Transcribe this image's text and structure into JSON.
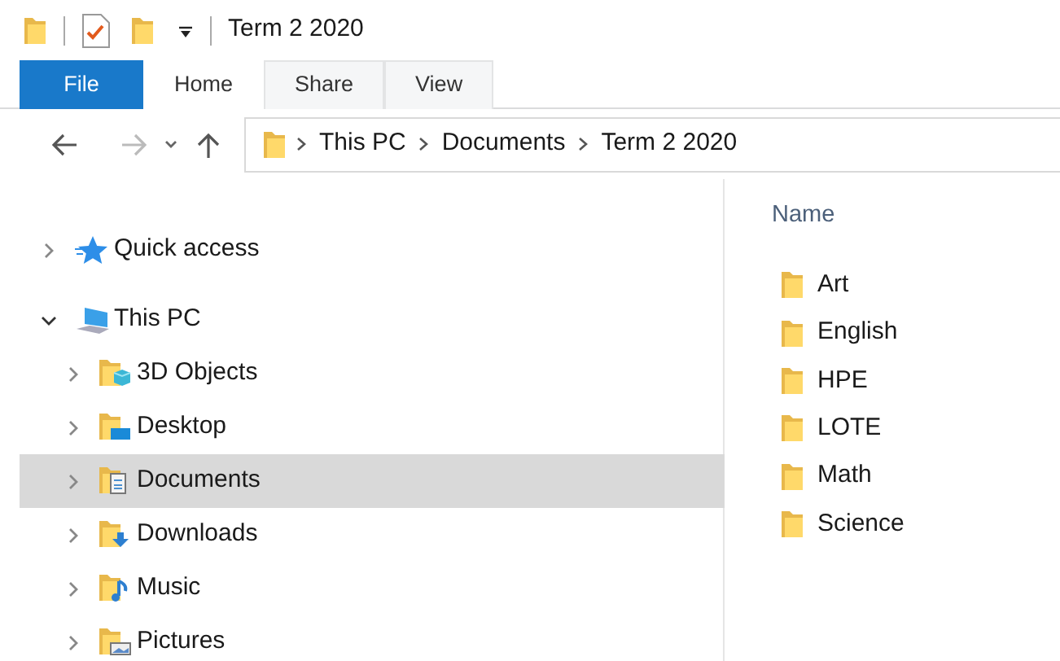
{
  "window": {
    "title": "Term 2 2020"
  },
  "ribbon_tabs": [
    {
      "label": "File",
      "kind": "file",
      "highlighted": false
    },
    {
      "label": "Home",
      "kind": "tab",
      "highlighted": false
    },
    {
      "label": "Share",
      "kind": "tab",
      "highlighted": true
    },
    {
      "label": "View",
      "kind": "tab",
      "highlighted": true
    }
  ],
  "address_bar": {
    "path": [
      "This PC",
      "Documents",
      "Term 2 2020"
    ]
  },
  "navigation_pane": {
    "items": [
      {
        "label": "Quick access",
        "kind": "star",
        "expanded": false,
        "selected": false
      },
      {
        "label": "This PC",
        "kind": "pc",
        "expanded": true,
        "selected": false,
        "children": [
          {
            "label": "3D Objects",
            "kind": "cube",
            "expanded": false,
            "selected": false
          },
          {
            "label": "Desktop",
            "kind": "desktop",
            "expanded": false,
            "selected": false
          },
          {
            "label": "Documents",
            "kind": "documents",
            "expanded": false,
            "selected": true
          },
          {
            "label": "Downloads",
            "kind": "downloads",
            "expanded": false,
            "selected": false
          },
          {
            "label": "Music",
            "kind": "music",
            "expanded": false,
            "selected": false
          },
          {
            "label": "Pictures",
            "kind": "pictures",
            "expanded": false,
            "selected": false
          }
        ]
      }
    ]
  },
  "file_list": {
    "columns": [
      "Name"
    ],
    "items": [
      "Art",
      "English",
      "HPE",
      "LOTE",
      "Math",
      "Science"
    ]
  }
}
